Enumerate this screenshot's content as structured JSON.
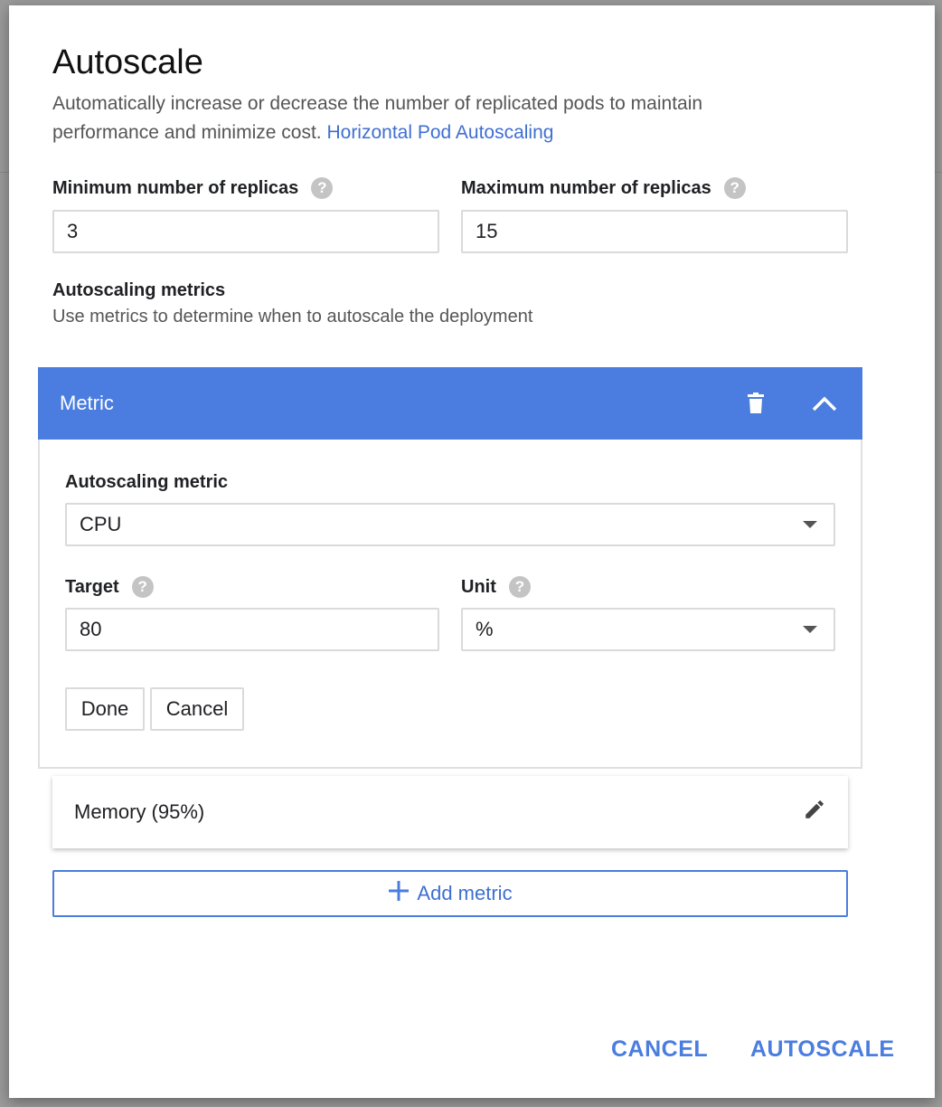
{
  "dialog": {
    "title": "Autoscale",
    "description": "Automatically increase or decrease the number of replicated pods to maintain performance and minimize cost.",
    "description_link": "Horizontal Pod Autoscaling"
  },
  "replicas": {
    "min_label": "Minimum number of replicas",
    "min_value": "3",
    "max_label": "Maximum number of replicas",
    "max_value": "15"
  },
  "metrics_section": {
    "title": "Autoscaling metrics",
    "subtitle": "Use metrics to determine when to autoscale the deployment"
  },
  "metric_panel": {
    "header": "Metric",
    "metric_label": "Autoscaling metric",
    "metric_value": "CPU",
    "target_label": "Target",
    "target_value": "80",
    "unit_label": "Unit",
    "unit_value": "%",
    "done_label": "Done",
    "cancel_label": "Cancel"
  },
  "existing_metric": {
    "label": "Memory (95%)"
  },
  "add_metric": {
    "label": "Add metric"
  },
  "footer": {
    "cancel_label": "CANCEL",
    "autoscale_label": "AUTOSCALE"
  },
  "colors": {
    "accent": "#4a7ddf",
    "link": "#3f6fd1"
  }
}
